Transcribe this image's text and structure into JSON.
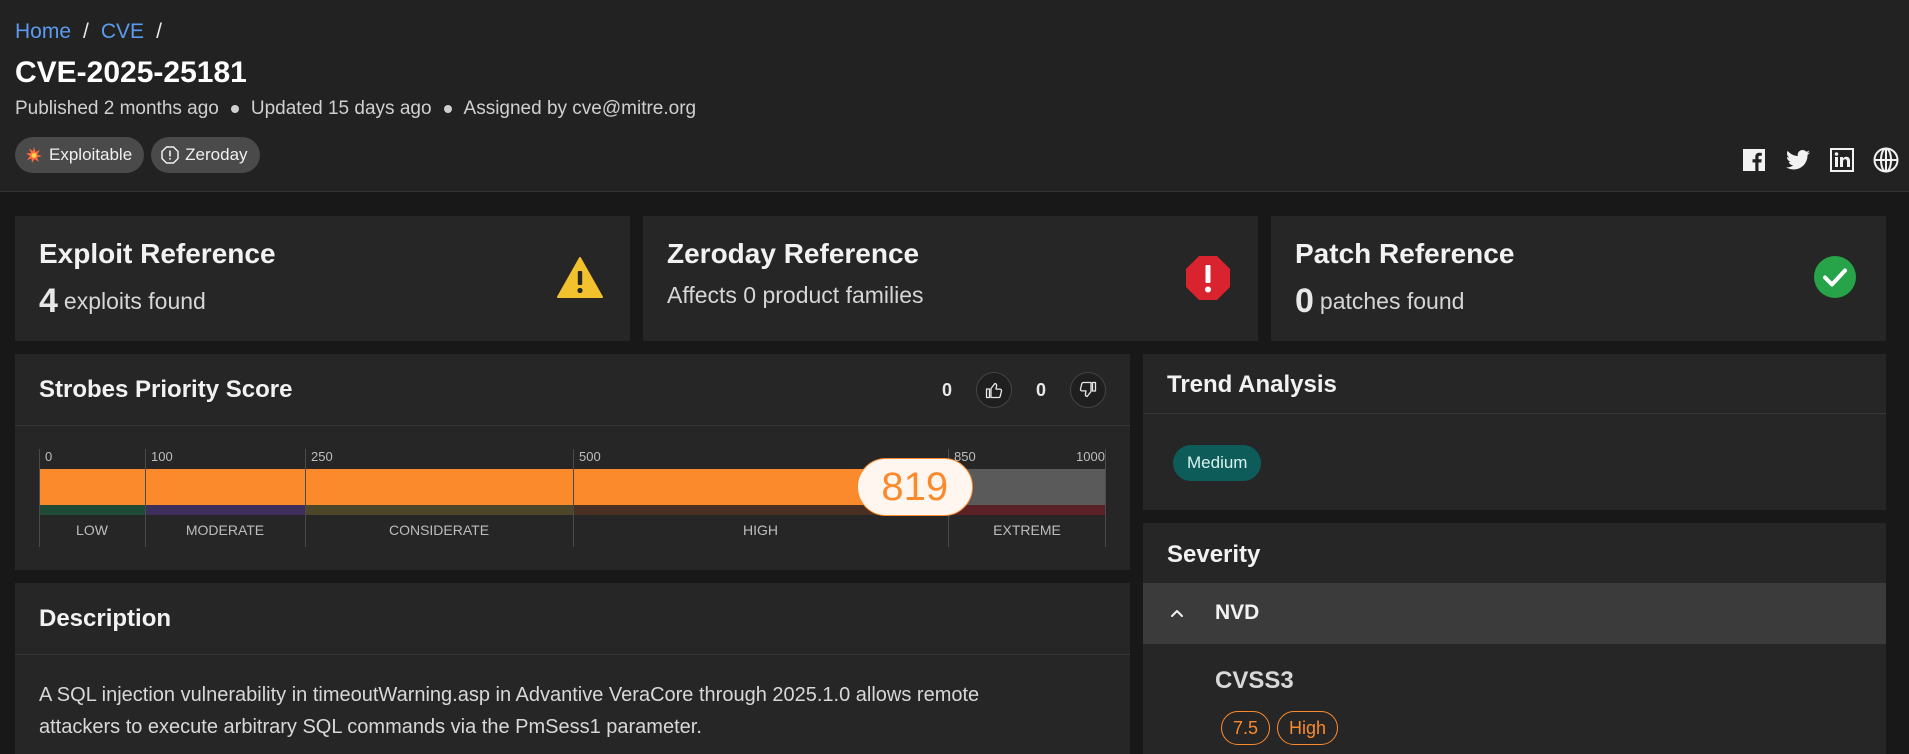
{
  "breadcrumb": {
    "home": "Home",
    "sep": "/",
    "cve": "CVE"
  },
  "title": "CVE-2025-25181",
  "meta": {
    "published": "Published 2 months ago",
    "updated": "Updated 15 days ago",
    "assigned": "Assigned by cve@mitre.org"
  },
  "tags": [
    {
      "label": "Exploitable",
      "icon": "explosion-icon"
    },
    {
      "label": "Zeroday",
      "icon": "warning-octagon-icon"
    }
  ],
  "social": [
    "facebook-icon",
    "twitter-icon",
    "linkedin-icon",
    "globe-icon"
  ],
  "exploit_ref": {
    "title": "Exploit Reference",
    "count": "4",
    "suffix": "exploits found",
    "icon": "warning-triangle-icon",
    "color": "#f2c12e"
  },
  "zeroday_ref": {
    "title": "Zeroday Reference",
    "text": "Affects 0 product families",
    "icon": "alert-octagon-icon",
    "color": "#d9232e"
  },
  "patch_ref": {
    "title": "Patch Reference",
    "count": "0",
    "suffix": "patches found",
    "icon": "check-circle-icon",
    "color": "#27a34a"
  },
  "priority": {
    "title": "Strobes Priority Score",
    "likes": "0",
    "dislikes": "0",
    "score": 819,
    "score_label": "819",
    "max": 1000,
    "ticks": [
      {
        "value": 0,
        "label": "0"
      },
      {
        "value": 100,
        "label": "100"
      },
      {
        "value": 250,
        "label": "250"
      },
      {
        "value": 500,
        "label": "500"
      },
      {
        "value": 850,
        "label": "850"
      },
      {
        "value": 1000,
        "label": "1000"
      }
    ],
    "bands": [
      {
        "from": 0,
        "to": 100,
        "label": "LOW",
        "color": "#1f4a35"
      },
      {
        "from": 100,
        "to": 250,
        "label": "MODERATE",
        "color": "#3d2e5c"
      },
      {
        "from": 250,
        "to": 500,
        "label": "CONSIDERATE",
        "color": "#4d4628"
      },
      {
        "from": 500,
        "to": 850,
        "label": "HIGH",
        "color": "#4a3022"
      },
      {
        "from": 850,
        "to": 1000,
        "label": "EXTREME",
        "color": "#5a2226"
      }
    ]
  },
  "description": {
    "title": "Description",
    "text": "A SQL injection vulnerability in timeoutWarning.asp in Advantive VeraCore through 2025.1.0 allows remote attackers to execute arbitrary SQL commands via the PmSess1 parameter."
  },
  "trend": {
    "title": "Trend Analysis",
    "badge": "Medium"
  },
  "severity": {
    "title": "Severity",
    "source": "NVD",
    "cvss_title": "CVSS3",
    "score": "7.5",
    "level": "High"
  }
}
